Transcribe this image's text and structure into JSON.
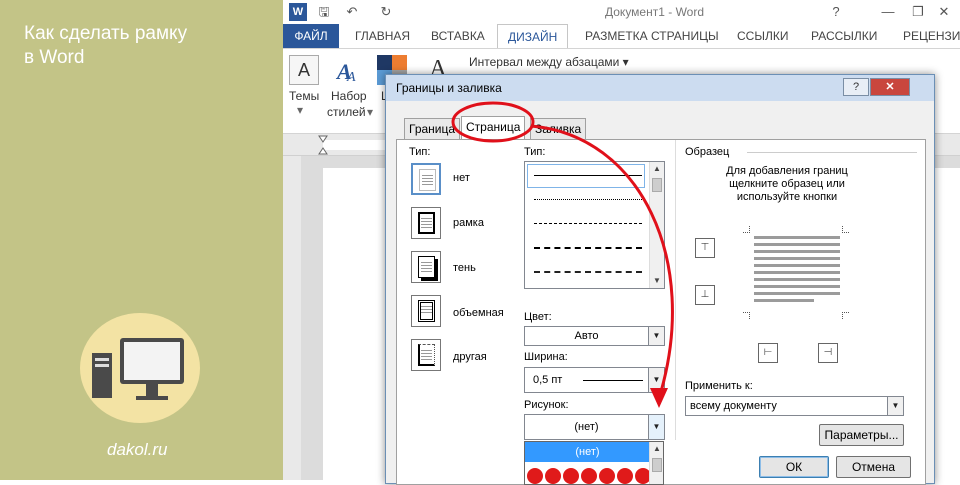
{
  "side": {
    "title_line1": "Как сделать рамку",
    "title_line2": "в Word",
    "site": "dakol.ru"
  },
  "window": {
    "title": "Документ1 - Word",
    "help": "?",
    "minimize": "—",
    "restore": "❐",
    "close": "✕"
  },
  "qat": {
    "word_icon": "W",
    "save": "🖫",
    "undo": "↶",
    "redo": "↻"
  },
  "tabs": [
    {
      "label": "ФАЙЛ"
    },
    {
      "label": "ГЛАВНАЯ"
    },
    {
      "label": "ВСТАВКА"
    },
    {
      "label": "ДИЗАЙН"
    },
    {
      "label": "РАЗМЕТКА СТРАНИЦЫ"
    },
    {
      "label": "ССЫЛКИ"
    },
    {
      "label": "РАССЫЛКИ"
    },
    {
      "label": "РЕЦЕНЗИРОВАНИЕ"
    }
  ],
  "ribbon": {
    "themes": "Темы",
    "themes_arrow": "▾",
    "styles_line1": "Набор",
    "styles_line2": "стилей",
    "styles_arrow": "▾",
    "colors_initial": "Ц",
    "paragraph_spacing": "Интервал между абзацами",
    "paragraph_spacing_arrow": "▾",
    "styles_icon": "A",
    "fonts_icon": "A"
  },
  "dialog": {
    "title": "Границы и заливка",
    "help": "?",
    "close": "✕",
    "tabs": [
      {
        "label": "Граница"
      },
      {
        "label": "Страница"
      },
      {
        "label": "Заливка"
      }
    ],
    "type_label": "Тип:",
    "types": [
      {
        "label": "нет"
      },
      {
        "label": "рамка"
      },
      {
        "label": "тень"
      },
      {
        "label": "объемная"
      },
      {
        "label": "другая"
      }
    ],
    "style_label": "Тип:",
    "color_label": "Цвет:",
    "color_value": "Авто",
    "width_label": "Ширина:",
    "width_value": "0,5 пт",
    "art_label": "Рисунок:",
    "art_value": "(нет)",
    "art_dropdown_selected": "(нет)",
    "preview_label": "Образец",
    "preview_hint": "Для добавления границ щелкните образец или используйте кнопки",
    "apply_label": "Применить к:",
    "apply_value": "всему документу",
    "options_button": "Параметры...",
    "ok_button": "ОК",
    "cancel_button": "Отмена"
  },
  "colors": {
    "side_bg": "#c3c487",
    "word_blue": "#2b579a",
    "annotation_red": "#e0101a",
    "dropdown_highlight": "#3399ff"
  }
}
